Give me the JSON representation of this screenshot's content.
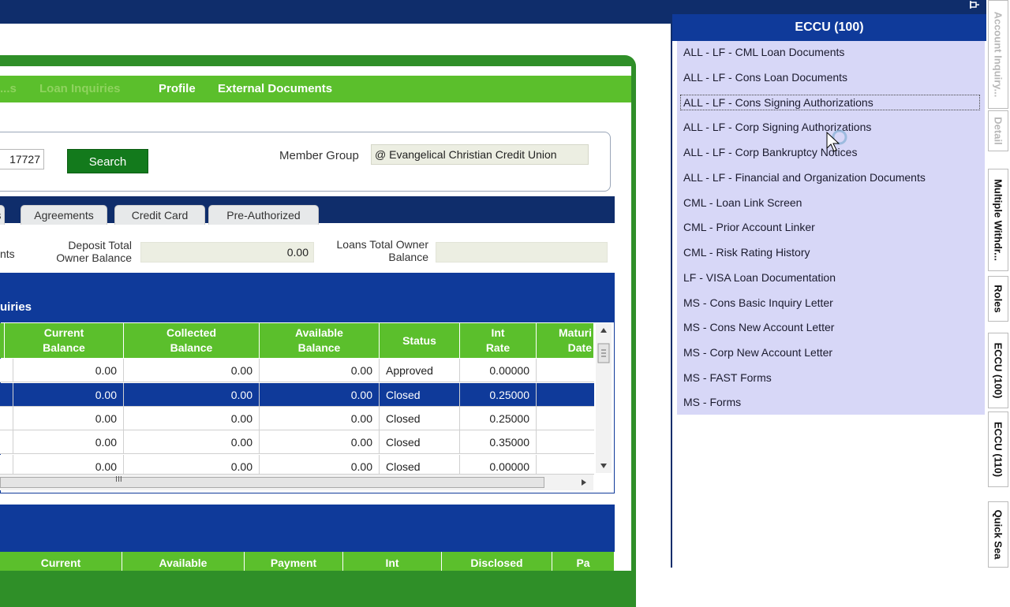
{
  "nav": {
    "faded_items": [
      "...s",
      "Loan Inquiries"
    ],
    "items": [
      "Profile",
      "External Documents"
    ]
  },
  "search": {
    "member_number": "17727",
    "search_label": "Search",
    "member_group_label": "Member Group",
    "member_group_value": "@ Evangelical Christian Credit Union"
  },
  "tabs": [
    "s",
    "Agreements",
    "Credit Card",
    "Pre-Authorized"
  ],
  "summary": {
    "left_label": "nts",
    "deposit_label_1": "Deposit Total",
    "deposit_label_2": "Owner Balance",
    "deposit_value": "0.00",
    "loans_label_1": "Loans Total Owner",
    "loans_label_2": "Balance",
    "loans_value": ""
  },
  "grid": {
    "section_title": "uiries",
    "headers": [
      {
        "l1": "Current",
        "l2": "Balance"
      },
      {
        "l1": "Collected",
        "l2": "Balance"
      },
      {
        "l1": "Available",
        "l2": "Balance"
      },
      {
        "l1": "Status",
        "l2": ""
      },
      {
        "l1": "Int",
        "l2": "Rate"
      },
      {
        "l1": "Maturi",
        "l2": "Date"
      }
    ],
    "rows": [
      {
        "current": "0.00",
        "collected": "0.00",
        "available": "0.00",
        "status": "Approved",
        "rate": "0.00000"
      },
      {
        "current": "0.00",
        "collected": "0.00",
        "available": "0.00",
        "status": "Closed",
        "rate": "0.25000"
      },
      {
        "current": "0.00",
        "collected": "0.00",
        "available": "0.00",
        "status": "Closed",
        "rate": "0.25000"
      },
      {
        "current": "0.00",
        "collected": "0.00",
        "available": "0.00",
        "status": "Closed",
        "rate": "0.35000"
      },
      {
        "current": "0.00",
        "collected": "0.00",
        "available": "0.00",
        "status": "Closed",
        "rate": "0.00000"
      }
    ],
    "hscroll_grip": "III"
  },
  "grid2": {
    "headers": [
      "Current",
      "Available",
      "Payment",
      "Int",
      "Disclosed",
      "Pa"
    ]
  },
  "panel": {
    "title": "ECCU (100)",
    "documents": [
      "ALL - LF - CML Loan Documents",
      "ALL - LF - Cons Loan Documents",
      "ALL - LF - Cons Signing Authorizations",
      "ALL - LF - Corp Signing Authorizations",
      "ALL - LF - Corp Bankruptcy Notices",
      "ALL - LF - Financial and Organization Documents",
      "CML - Loan Link Screen",
      "CML - Prior Account Linker",
      "CML - Risk Rating History",
      "LF - VISA Loan Documentation",
      "MS - Cons Basic Inquiry Letter",
      "MS - Cons New Account Letter",
      "MS - Corp New Account Letter",
      "MS - FAST Forms",
      "MS - Forms"
    ]
  },
  "side_tabs": [
    "Account Inquiry...",
    "Detail",
    "Multiple Withdr...",
    "Roles",
    "ECCU (100)",
    "ECCU (110)",
    "Quick Sea"
  ],
  "colors": {
    "navy": "#0f2d6b",
    "blue": "#0f3a9a",
    "green": "#5bbf2c",
    "dark_green": "#137a1c",
    "list_bg": "#d7d7f7"
  }
}
